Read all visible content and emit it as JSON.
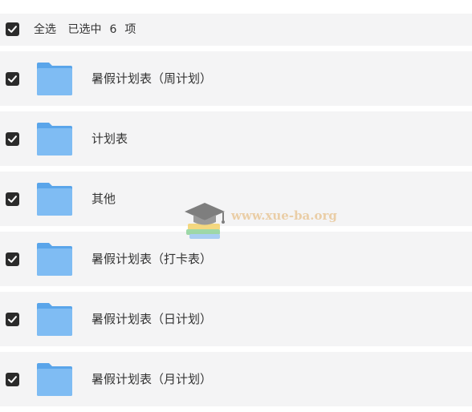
{
  "header": {
    "select_all_label": "全选",
    "selected_prefix": "已选中",
    "selected_count": "6",
    "selected_suffix": "项",
    "checked": true
  },
  "folders": [
    {
      "name": "暑假计划表（周计划）",
      "checked": true,
      "icon": "folder-icon"
    },
    {
      "name": "计划表",
      "checked": true,
      "icon": "folder-icon"
    },
    {
      "name": "其他",
      "checked": true,
      "icon": "folder-icon"
    },
    {
      "name": "暑假计划表（打卡表）",
      "checked": true,
      "icon": "folder-icon"
    },
    {
      "name": "暑假计划表（日计划）",
      "checked": true,
      "icon": "folder-icon"
    },
    {
      "name": "暑假计划表（月计划）",
      "checked": true,
      "icon": "folder-icon"
    }
  ],
  "watermark": {
    "text": "www.xue-ba.org"
  },
  "colors": {
    "row_background": "#f4f4f5",
    "checkbox": "#2b2b2b",
    "folder_front": "#7fbcf3",
    "folder_back": "#5aa5ea",
    "text": "#333333"
  }
}
